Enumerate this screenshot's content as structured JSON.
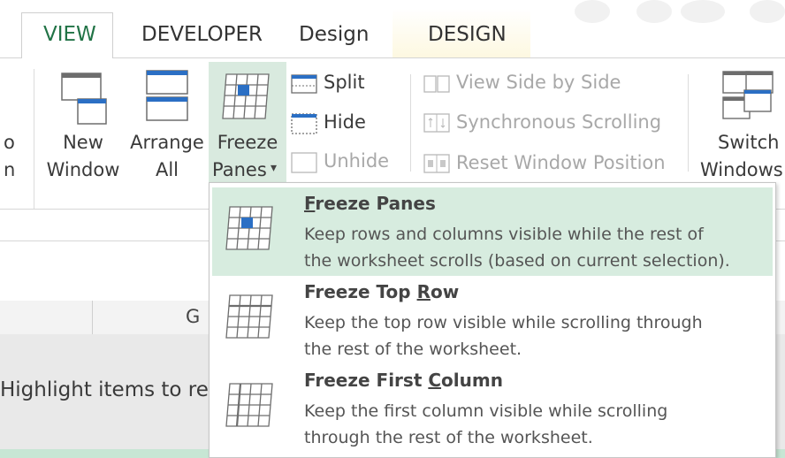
{
  "tabs": [
    {
      "label": "VIEW",
      "active": true
    },
    {
      "label": "DEVELOPER",
      "active": false
    },
    {
      "label": "Design",
      "active": false
    },
    {
      "label": "DESIGN",
      "active": false
    }
  ],
  "ribbon": {
    "cut_left": {
      "line1": "o",
      "line2": "n"
    },
    "new_window": {
      "line1": "New",
      "line2": "Window"
    },
    "arrange_all": {
      "line1": "Arrange",
      "line2": "All"
    },
    "freeze_panes": {
      "line1": "Freeze",
      "line2": "Panes",
      "arrow": "▾"
    },
    "split": "Split",
    "hide": "Hide",
    "unhide": "Unhide",
    "view_side_by_side": "View Side by Side",
    "synchronous_scrolling": "Synchronous Scrolling",
    "reset_window_position": "Reset Window Position",
    "switch_windows": {
      "line1": "Switch",
      "line2": "Windows"
    }
  },
  "sheet": {
    "column_header": "G",
    "highlight_text": "Highlight items to re"
  },
  "freeze_menu": {
    "items": [
      {
        "title_pre": "",
        "title_key": "F",
        "title_post": "reeze Panes",
        "desc1": "Keep rows and columns visible while the rest of",
        "desc2": "the worksheet scrolls (based on current selection).",
        "selected": true
      },
      {
        "title_pre": "Freeze Top ",
        "title_key": "R",
        "title_post": "ow",
        "desc1": "Keep the top row visible while scrolling through",
        "desc2": "the rest of the worksheet.",
        "selected": false
      },
      {
        "title_pre": "Freeze First ",
        "title_key": "C",
        "title_post": "olumn",
        "desc1": "Keep the first column visible while scrolling",
        "desc2": "through the rest of the worksheet.",
        "selected": false
      }
    ]
  },
  "colors": {
    "accent_green": "#217346",
    "selected_bg": "#d7ecdf",
    "freeze_icon_blue": "#2b6fc4"
  }
}
